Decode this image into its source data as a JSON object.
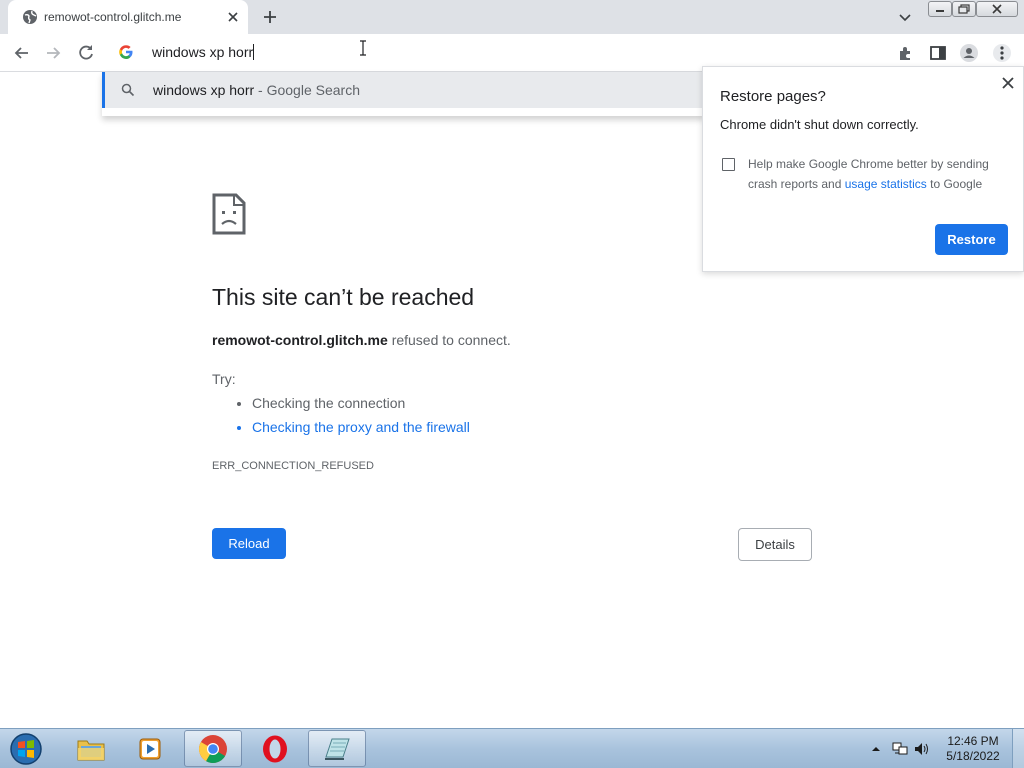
{
  "browser": {
    "tab": {
      "title": "remowot-control.glitch.me"
    },
    "omnibox": {
      "value": "windows xp horr"
    },
    "suggestion": {
      "query": "windows xp horr",
      "suffix": "- Google Search"
    }
  },
  "error_page": {
    "title": "This site can’t be reached",
    "host": "remowot-control.glitch.me",
    "message": "refused to connect.",
    "try_label": "Try:",
    "suggestions": [
      "Checking the connection",
      "Checking the proxy and the firewall"
    ],
    "error_code": "ERR_CONNECTION_REFUSED",
    "reload_label": "Reload",
    "details_label": "Details"
  },
  "restore_bubble": {
    "title": "Restore pages?",
    "message": "Chrome didn't shut down correctly.",
    "checkbox_text_1": "Help make Google Chrome better by sending crash reports and",
    "checkbox_link": "usage statistics",
    "checkbox_text_2": "to Google",
    "checked": false,
    "restore_label": "Restore"
  },
  "taskbar": {
    "time": "12:46 PM",
    "date": "5/18/2022",
    "apps": [
      "windows-explorer",
      "media-player",
      "chrome",
      "opera",
      "notepad"
    ]
  },
  "colors": {
    "accent": "#1a73e8",
    "tabstrip": "#dee1e6",
    "error_text": "#5f6368"
  }
}
